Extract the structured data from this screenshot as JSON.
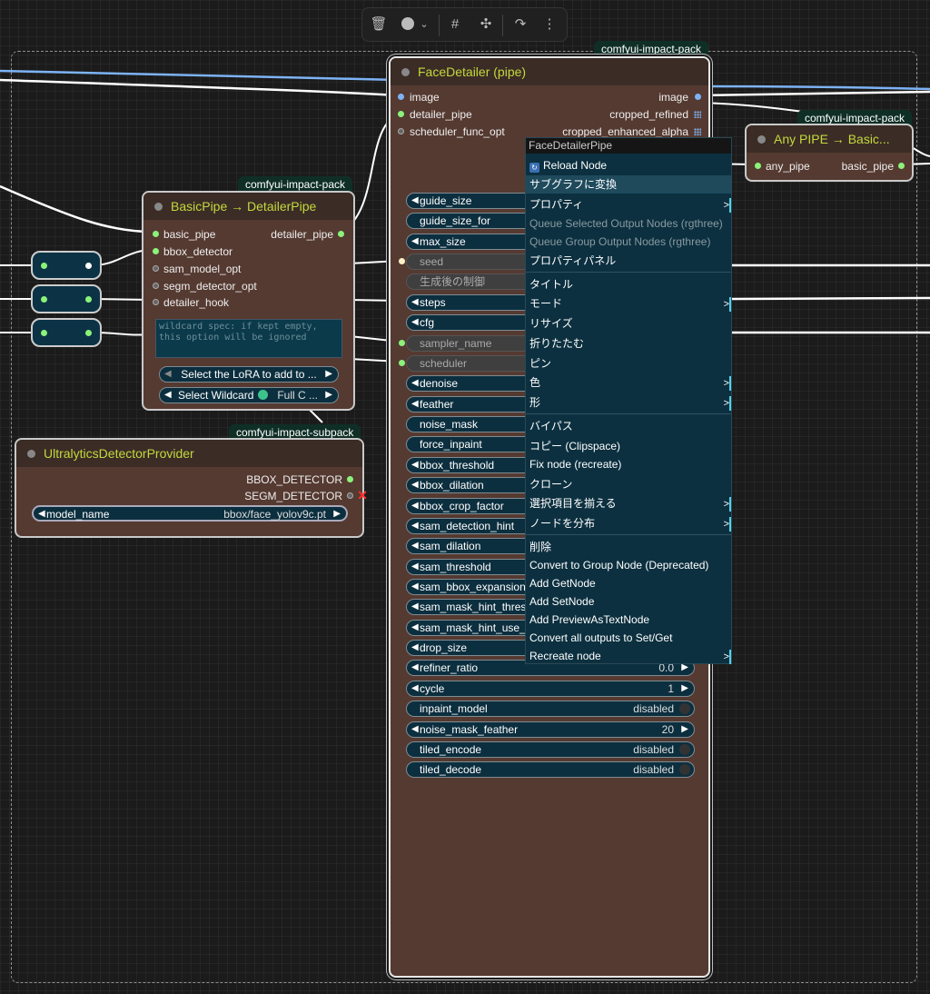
{
  "toolbar": {
    "icons": [
      "trash-icon",
      "color-circle-icon",
      "chevron-down-icon",
      "frame-icon",
      "collapse-icon",
      "redo-icon",
      "more-icon"
    ]
  },
  "face_detailer": {
    "badge": "comfyui-impact-pack",
    "title": "FaceDetailer (pipe)",
    "inputs": [
      "image",
      "detailer_pipe",
      "scheduler_func_opt"
    ],
    "outputs": [
      "image",
      "cropped_refined",
      "cropped_enhanced_alpha"
    ],
    "widgets": [
      {
        "label": "guide_size",
        "value": ""
      },
      {
        "label": "guide_size_for",
        "value": ""
      },
      {
        "label": "max_size",
        "value": ""
      },
      {
        "label": "seed",
        "value": ""
      },
      {
        "label": "生成後の制御",
        "value": ""
      },
      {
        "label": "steps",
        "value": ""
      },
      {
        "label": "cfg",
        "value": ""
      },
      {
        "label": "sampler_name",
        "value": ""
      },
      {
        "label": "scheduler",
        "value": ""
      },
      {
        "label": "denoise",
        "value": ""
      },
      {
        "label": "feather",
        "value": ""
      },
      {
        "label": "noise_mask",
        "value": ""
      },
      {
        "label": "force_inpaint",
        "value": ""
      },
      {
        "label": "bbox_threshold",
        "value": ""
      },
      {
        "label": "bbox_dilation",
        "value": ""
      },
      {
        "label": "bbox_crop_factor",
        "value": ""
      },
      {
        "label": "sam_detection_hint",
        "value": ""
      },
      {
        "label": "sam_dilation",
        "value": ""
      },
      {
        "label": "sam_threshold",
        "value": ""
      },
      {
        "label": "sam_bbox_expansion",
        "value": ""
      },
      {
        "label": "sam_mask_hint_thres",
        "value": ""
      },
      {
        "label": "sam_mask_hint_use_n",
        "value": ""
      },
      {
        "label": "drop_size",
        "value": ""
      },
      {
        "label": "refiner_ratio",
        "value": "0.0"
      },
      {
        "label": "cycle",
        "value": "1"
      },
      {
        "label": "inpaint_model",
        "value": "disabled"
      },
      {
        "label": "noise_mask_feather",
        "value": "20"
      },
      {
        "label": "tiled_encode",
        "value": "disabled"
      },
      {
        "label": "tiled_decode",
        "value": "disabled"
      }
    ]
  },
  "basic_pipe": {
    "badge": "comfyui-impact-pack",
    "title": "BasicPipe → DetailerPipe",
    "inputs": [
      "basic_pipe",
      "bbox_detector",
      "sam_model_opt",
      "segm_detector_opt",
      "detailer_hook"
    ],
    "output": "detailer_pipe",
    "placeholder": "wildcard spec: if kept empty, this option will be ignored",
    "lora_btn": "Select the LoRA to add to ...",
    "wildcard_btn": "Select Wildcard",
    "wildcard_val": "Full C ..."
  },
  "any_pipe": {
    "badge": "comfyui-impact-pack",
    "title": "Any PIPE → Basic...",
    "input": "any_pipe",
    "output": "basic_pipe"
  },
  "ultra": {
    "badge": "comfyui-impact-subpack",
    "title": "UltralyticsDetectorProvider",
    "outputs": [
      "BBOX_DETECTOR",
      "SEGM_DETECTOR"
    ],
    "model_label": "model_name",
    "model_value": "bbox/face_yolov9c.pt"
  },
  "menu": {
    "title": "FaceDetailerPipe",
    "items": [
      {
        "label": "Reload Node"
      },
      {
        "label": "サブグラフに変換"
      },
      {
        "label": "プロパティ"
      },
      {
        "label": "Queue Selected Output Nodes (rgthree)"
      },
      {
        "label": "Queue Group Output Nodes (rgthree)"
      },
      {
        "label": "プロパティパネル"
      },
      {
        "label": "タイトル"
      },
      {
        "label": "モード"
      },
      {
        "label": "リサイズ"
      },
      {
        "label": "折りたたむ"
      },
      {
        "label": "ピン"
      },
      {
        "label": "色"
      },
      {
        "label": "形"
      },
      {
        "label": "バイパス"
      },
      {
        "label": "コピー (Clipspace)"
      },
      {
        "label": "Fix node (recreate)"
      },
      {
        "label": "クローン"
      },
      {
        "label": "選択項目を揃える"
      },
      {
        "label": "ノードを分布"
      },
      {
        "label": "削除"
      },
      {
        "label": "Convert to Group Node (Deprecated)"
      },
      {
        "label": "Add GetNode"
      },
      {
        "label": "Add SetNode"
      },
      {
        "label": "Add PreviewAsTextNode"
      },
      {
        "label": "Convert all outputs to Set/Get"
      },
      {
        "label": "Recreate node"
      }
    ]
  }
}
